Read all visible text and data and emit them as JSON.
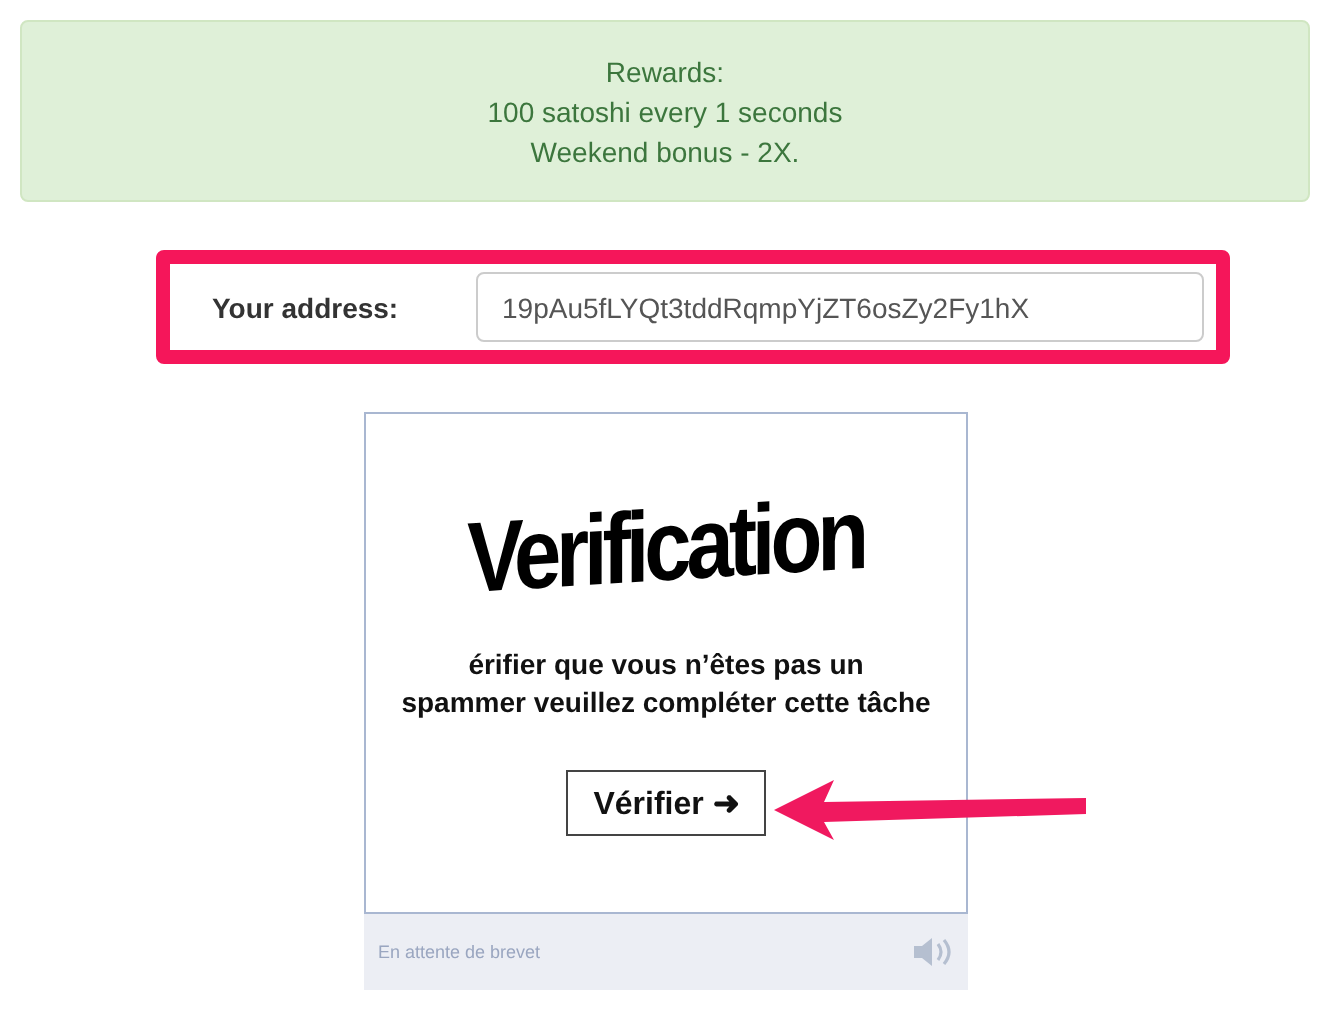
{
  "rewards": {
    "lines": [
      "Rewards:",
      "100 satoshi every 1 seconds",
      "Weekend bonus - 2X."
    ]
  },
  "address": {
    "label": "Your address:",
    "value": "19pAu5fLYQt3tddRqmpYjZT6osZy2Fy1hX"
  },
  "captcha": {
    "title": "Verification",
    "message_lines": [
      "érifier que vous n’êtes pas un",
      "spammer veuillez compléter cette tâche"
    ],
    "button": "Vérifier",
    "button_arrow": "➜",
    "footer": "En attente de brevet"
  }
}
